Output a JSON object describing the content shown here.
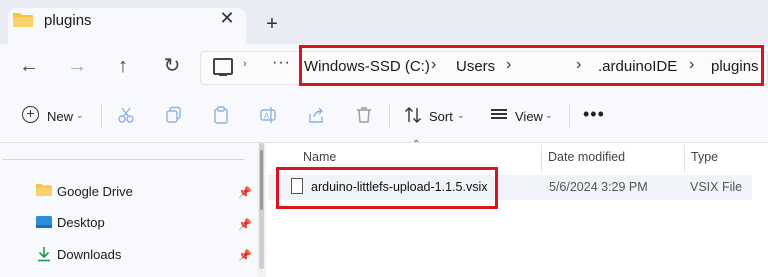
{
  "tab": {
    "title": "plugins",
    "close": "✕",
    "new_tab": "+"
  },
  "nav": {
    "back": "←",
    "forward": "→",
    "up": "↑",
    "refresh": "↻",
    "more": "···",
    "chevron": "⌄"
  },
  "breadcrumb": [
    {
      "label": "Windows-SSD (C:)"
    },
    {
      "label": "Users"
    },
    {
      "label": ""
    },
    {
      "label": ".arduinoIDE"
    },
    {
      "label": "plugins"
    }
  ],
  "separator": "›",
  "toolbar": {
    "new_label": "New",
    "sort_label": "Sort",
    "view_label": "View",
    "more": "•••",
    "chevron": "⌄"
  },
  "icons": {
    "new": "new-icon",
    "cut": "scissors-icon",
    "copy": "copy-icon",
    "paste": "paste-icon",
    "rename": "rename-icon",
    "share": "share-icon",
    "delete": "trash-icon",
    "sort": "sort-icon",
    "view": "view-icon"
  },
  "sidebar": {
    "items": [
      {
        "label": "Google Drive",
        "icon": "folder-icon"
      },
      {
        "label": "Desktop",
        "icon": "desktop-icon"
      },
      {
        "label": "Downloads",
        "icon": "download-icon"
      }
    ]
  },
  "columns": {
    "name": "Name",
    "date": "Date modified",
    "type": "Type"
  },
  "files": [
    {
      "name": "arduino-littlefs-upload-1.1.5.vsix",
      "date": "5/6/2024 3:29 PM",
      "type": "VSIX File"
    }
  ],
  "colors": {
    "highlight": "#d9141e",
    "folder": "#f4c542",
    "accent": "#0067c0"
  }
}
